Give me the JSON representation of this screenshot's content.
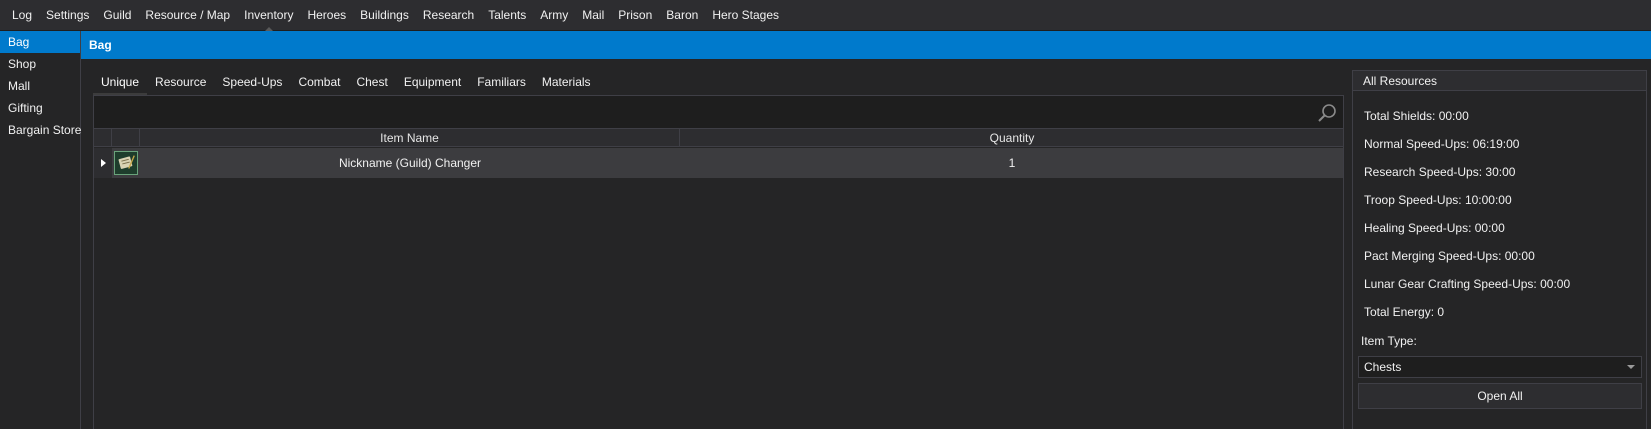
{
  "menu": {
    "items": [
      "Log",
      "Settings",
      "Guild",
      "Resource / Map",
      "Inventory",
      "Heroes",
      "Buildings",
      "Research",
      "Talents",
      "Army",
      "Mail",
      "Prison",
      "Baron",
      "Hero Stages"
    ],
    "active_index": 4
  },
  "sidebar": {
    "items": [
      "Bag",
      "Shop",
      "Mall",
      "Gifting",
      "Bargain Store"
    ],
    "active_index": 0
  },
  "header": {
    "title": "Bag"
  },
  "tabs": {
    "items": [
      "Unique",
      "Resource",
      "Speed-Ups",
      "Combat",
      "Chest",
      "Equipment",
      "Familiars",
      "Materials"
    ],
    "active_index": 0
  },
  "grid": {
    "columns": {
      "name": "Item Name",
      "quantity": "Quantity"
    },
    "rows": [
      {
        "name": "Nickname (Guild) Changer",
        "quantity": "1"
      }
    ]
  },
  "resources": {
    "title": "All Resources",
    "items": [
      "Total Shields: 00:00",
      "Normal Speed-Ups: 06:19:00",
      "Research Speed-Ups: 30:00",
      "Troop Speed-Ups: 10:00:00",
      "Healing Speed-Ups: 00:00",
      "Pact Merging Speed-Ups: 00:00",
      "Lunar Gear Crafting Speed-Ups: 00:00",
      "Total Energy: 0"
    ],
    "item_type_label": "Item Type:",
    "item_type_value": "Chests",
    "open_all_label": "Open All"
  },
  "colors": {
    "accent": "#007acc",
    "background": "#252526",
    "menu_background": "#2d2d30"
  }
}
